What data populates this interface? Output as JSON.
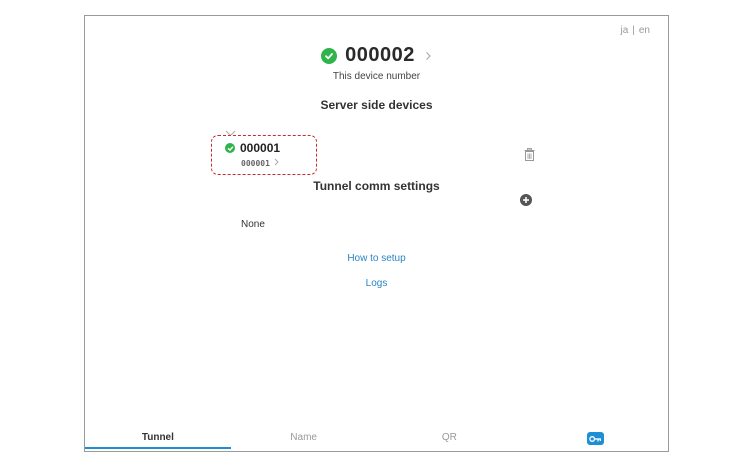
{
  "lang": {
    "ja": "ja",
    "separator": "|",
    "en": "en"
  },
  "device": {
    "number": "000002",
    "subtitle": "This device number",
    "status": "online"
  },
  "server_section": {
    "title": "Server side devices",
    "devices": [
      {
        "name": "000001",
        "sub": "000001",
        "status": "online"
      }
    ]
  },
  "tunnel_section": {
    "title": "Tunnel comm settings",
    "empty_text": "None"
  },
  "links": {
    "how_to_setup": "How to setup",
    "logs": "Logs"
  },
  "nav": {
    "tabs": [
      "Tunnel",
      "Name",
      "QR"
    ],
    "active": "Tunnel",
    "icon": "key-icon"
  },
  "colors": {
    "accent": "#1e8fd3",
    "ok": "#2eb44a",
    "link": "#2a84c4",
    "highlight": "#cc2b2b"
  },
  "icons": {
    "status": "check-circle-icon",
    "chevron": "chevron-right-icon",
    "collapse": "chevron-down-icon",
    "trash": "trash-icon",
    "add": "plus-circle-icon"
  }
}
